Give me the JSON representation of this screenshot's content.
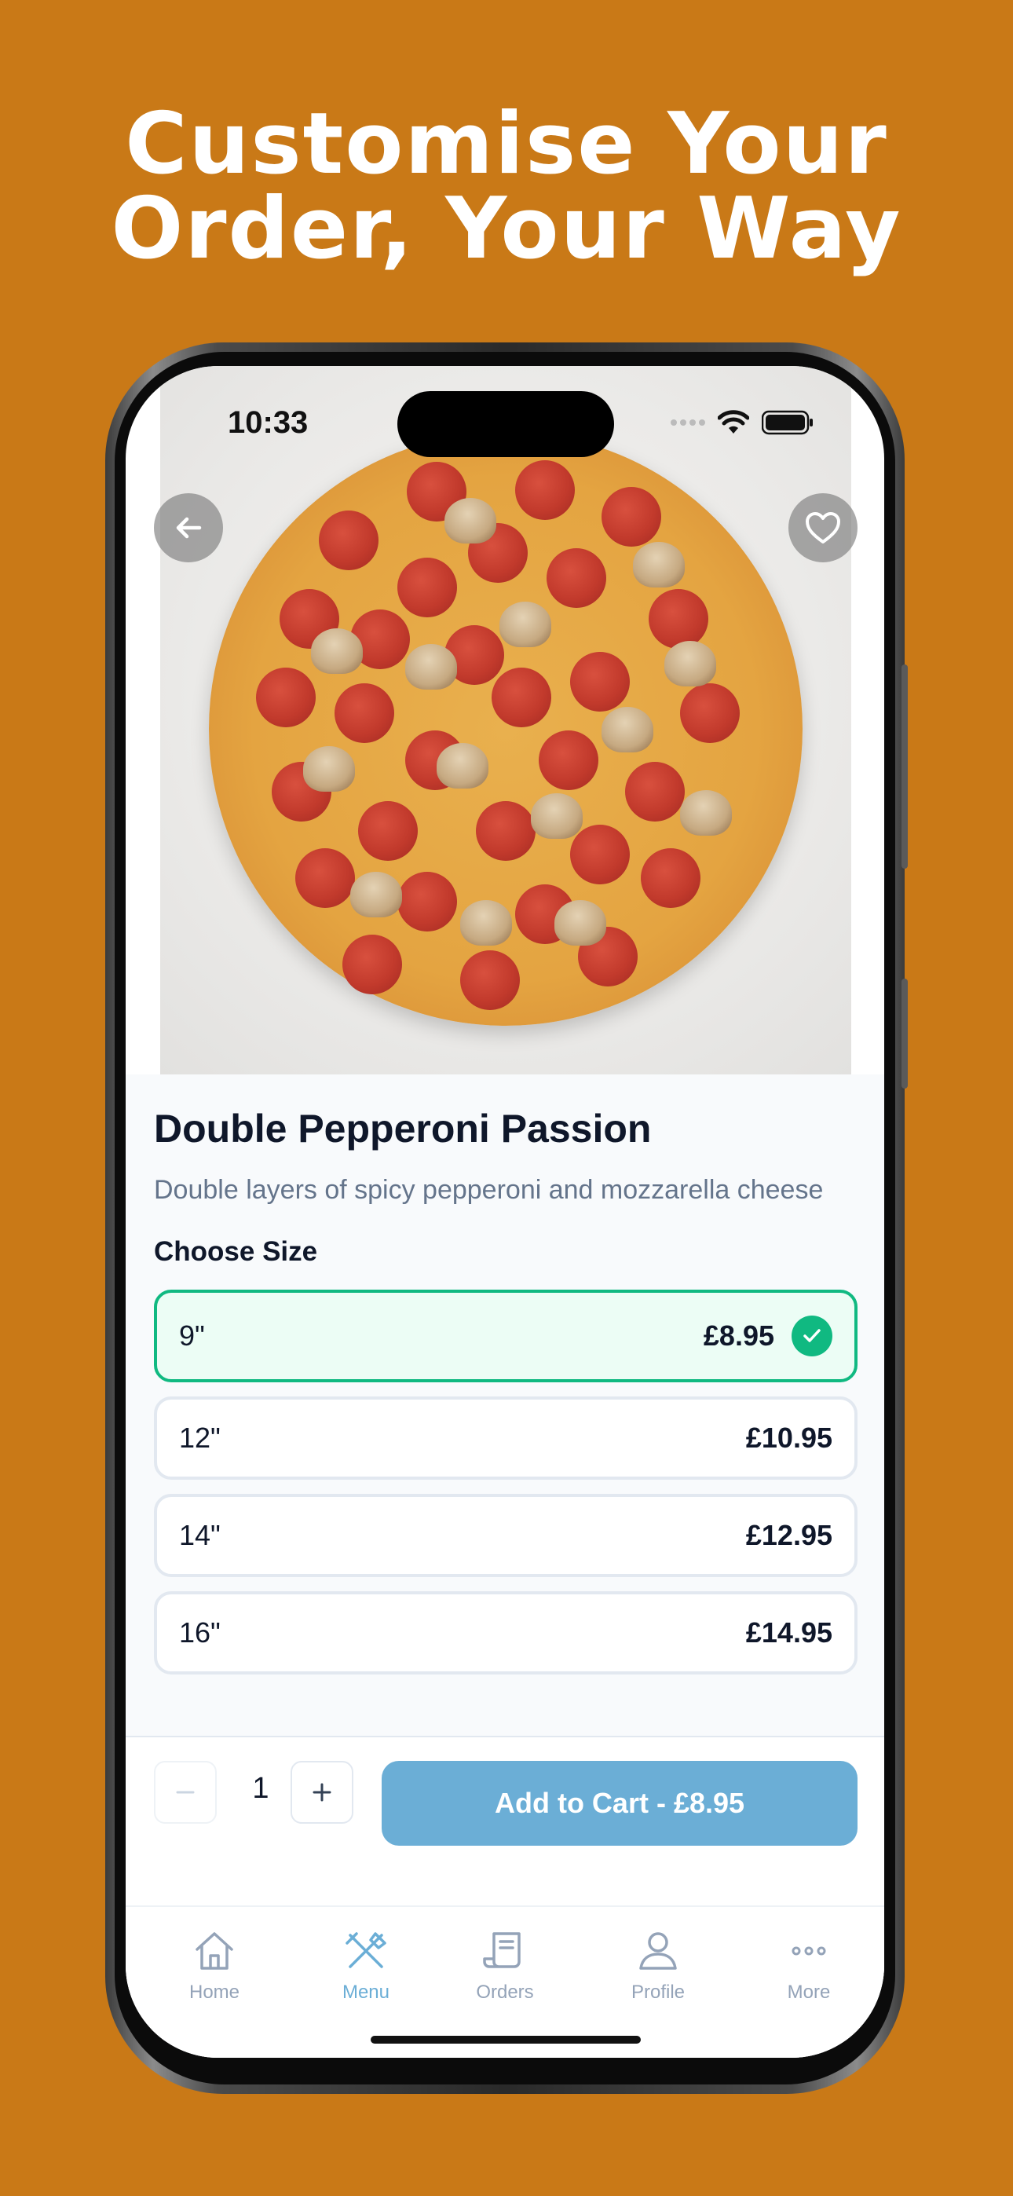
{
  "headline": {
    "line1": "Customise Your",
    "line2": "Order, Your Way"
  },
  "status_bar": {
    "time": "10:33",
    "icons": [
      "signal-dots-icon",
      "wifi-icon",
      "battery-icon"
    ]
  },
  "hero": {
    "back_icon": "arrow-left-icon",
    "favorite_icon": "heart-icon",
    "image": "pepperoni-mushroom-pizza"
  },
  "product": {
    "name": "Double Pepperoni Passion",
    "description": "Double layers of spicy pepperoni and mozzarella cheese",
    "choose_size_label": "Choose Size",
    "sizes": [
      {
        "label": "9\"",
        "price": "£8.95",
        "selected": true
      },
      {
        "label": "12\"",
        "price": "£10.95",
        "selected": false
      },
      {
        "label": "14\"",
        "price": "£12.95",
        "selected": false
      },
      {
        "label": "16\"",
        "price": "£14.95",
        "selected": false
      }
    ]
  },
  "cart": {
    "decrement_icon": "minus-icon",
    "increment_icon": "plus-icon",
    "quantity": "1",
    "add_to_cart_label": "Add to Cart - £8.95"
  },
  "tabbar": {
    "items": [
      {
        "label": "Home",
        "icon": "home-icon",
        "active": false
      },
      {
        "label": "Menu",
        "icon": "utensils-icon",
        "active": true
      },
      {
        "label": "Orders",
        "icon": "receipt-icon",
        "active": false
      },
      {
        "label": "Profile",
        "icon": "user-icon",
        "active": false
      },
      {
        "label": "More",
        "icon": "more-dots-icon",
        "active": false
      }
    ]
  },
  "colors": {
    "background": "#C97917",
    "accent_green": "#10B981",
    "accent_blue": "#6BAED6",
    "text_dark": "#0F172A",
    "text_muted": "#64748B"
  }
}
